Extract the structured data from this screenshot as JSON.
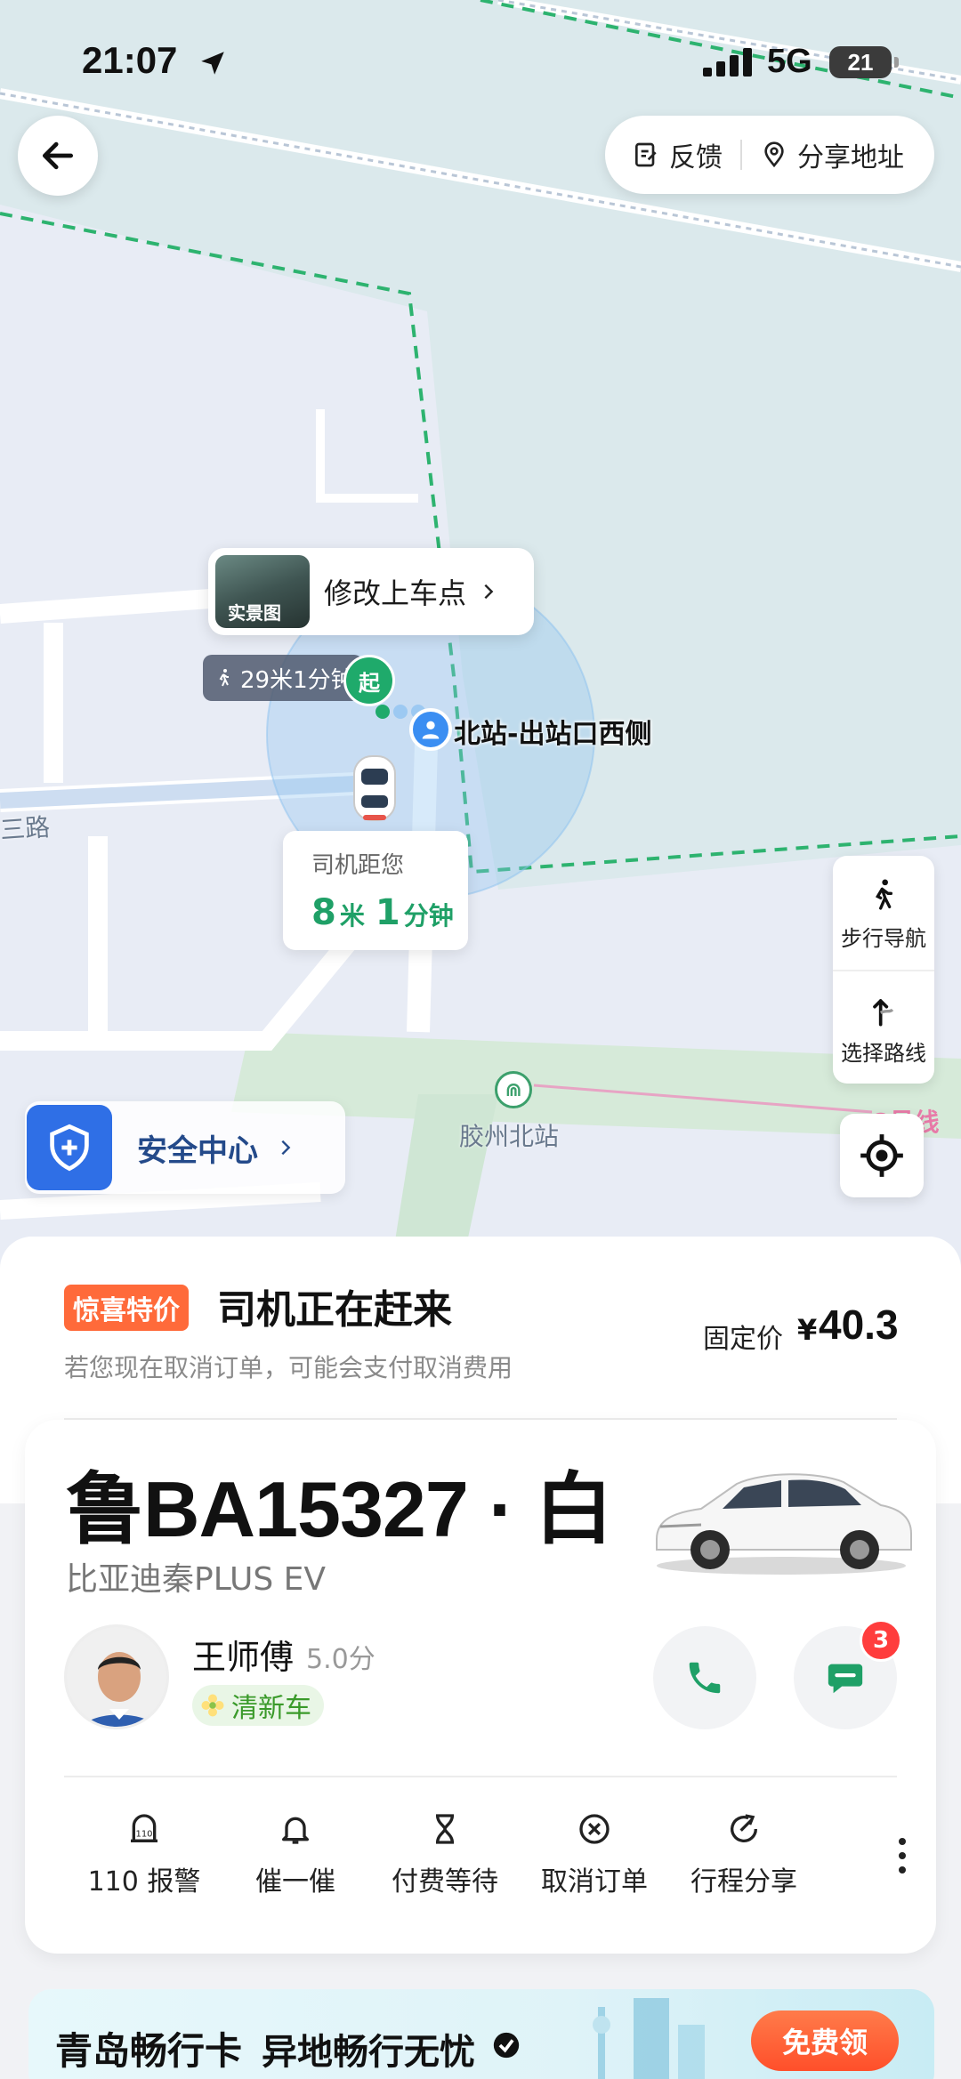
{
  "status_bar": {
    "time": "21:07",
    "network": "5G",
    "battery": "21"
  },
  "top_actions": {
    "feedback": "反馈",
    "share_address": "分享地址"
  },
  "map": {
    "pickup_edit": {
      "thumb_label": "实景图",
      "label": "修改上车点"
    },
    "walk_info": "29米1分钟",
    "start_marker": "起",
    "station_name": "北站-出站口西侧",
    "driver_eta": {
      "label": "司机距您",
      "distance_value": "8",
      "distance_unit": "米",
      "time_value": "1",
      "time_unit": "分钟"
    },
    "road_label": "三路",
    "metro_station": "胶州北站",
    "metro_line": "8号线",
    "tools": {
      "walk_nav": "步行导航",
      "choose_route": "选择路线"
    },
    "safety_center": "安全中心"
  },
  "order": {
    "promo_badge": "惊喜特价",
    "status_title": "司机正在赶来",
    "cancel_hint": "若您现在取消订单，可能会支付取消费用",
    "price_label": "固定价",
    "price_currency": "¥",
    "price_value": "40.3"
  },
  "vehicle": {
    "plate": "鲁BA15327 · 白",
    "model": "比亚迪秦PLUS EV",
    "driver_name": "王师傅",
    "rating": "5.0分",
    "clean_badge": "清新车",
    "message_count": "3"
  },
  "actions": [
    {
      "label": "110 报警",
      "icon": "police-110-icon"
    },
    {
      "label": "催一催",
      "icon": "bell-icon"
    },
    {
      "label": "付费等待",
      "icon": "hourglass-icon"
    },
    {
      "label": "取消订单",
      "icon": "cancel-circle-icon"
    },
    {
      "label": "行程分享",
      "icon": "share-icon"
    }
  ],
  "banner": {
    "title": "青岛畅行卡",
    "subtitle": "异地畅行无忧",
    "button": "免费领"
  },
  "colors": {
    "accent_green": "#1fa067",
    "promo_orange": "#ff6a3a",
    "safety_blue": "#2f6fe6",
    "badge_red": "#ff3d3d"
  }
}
